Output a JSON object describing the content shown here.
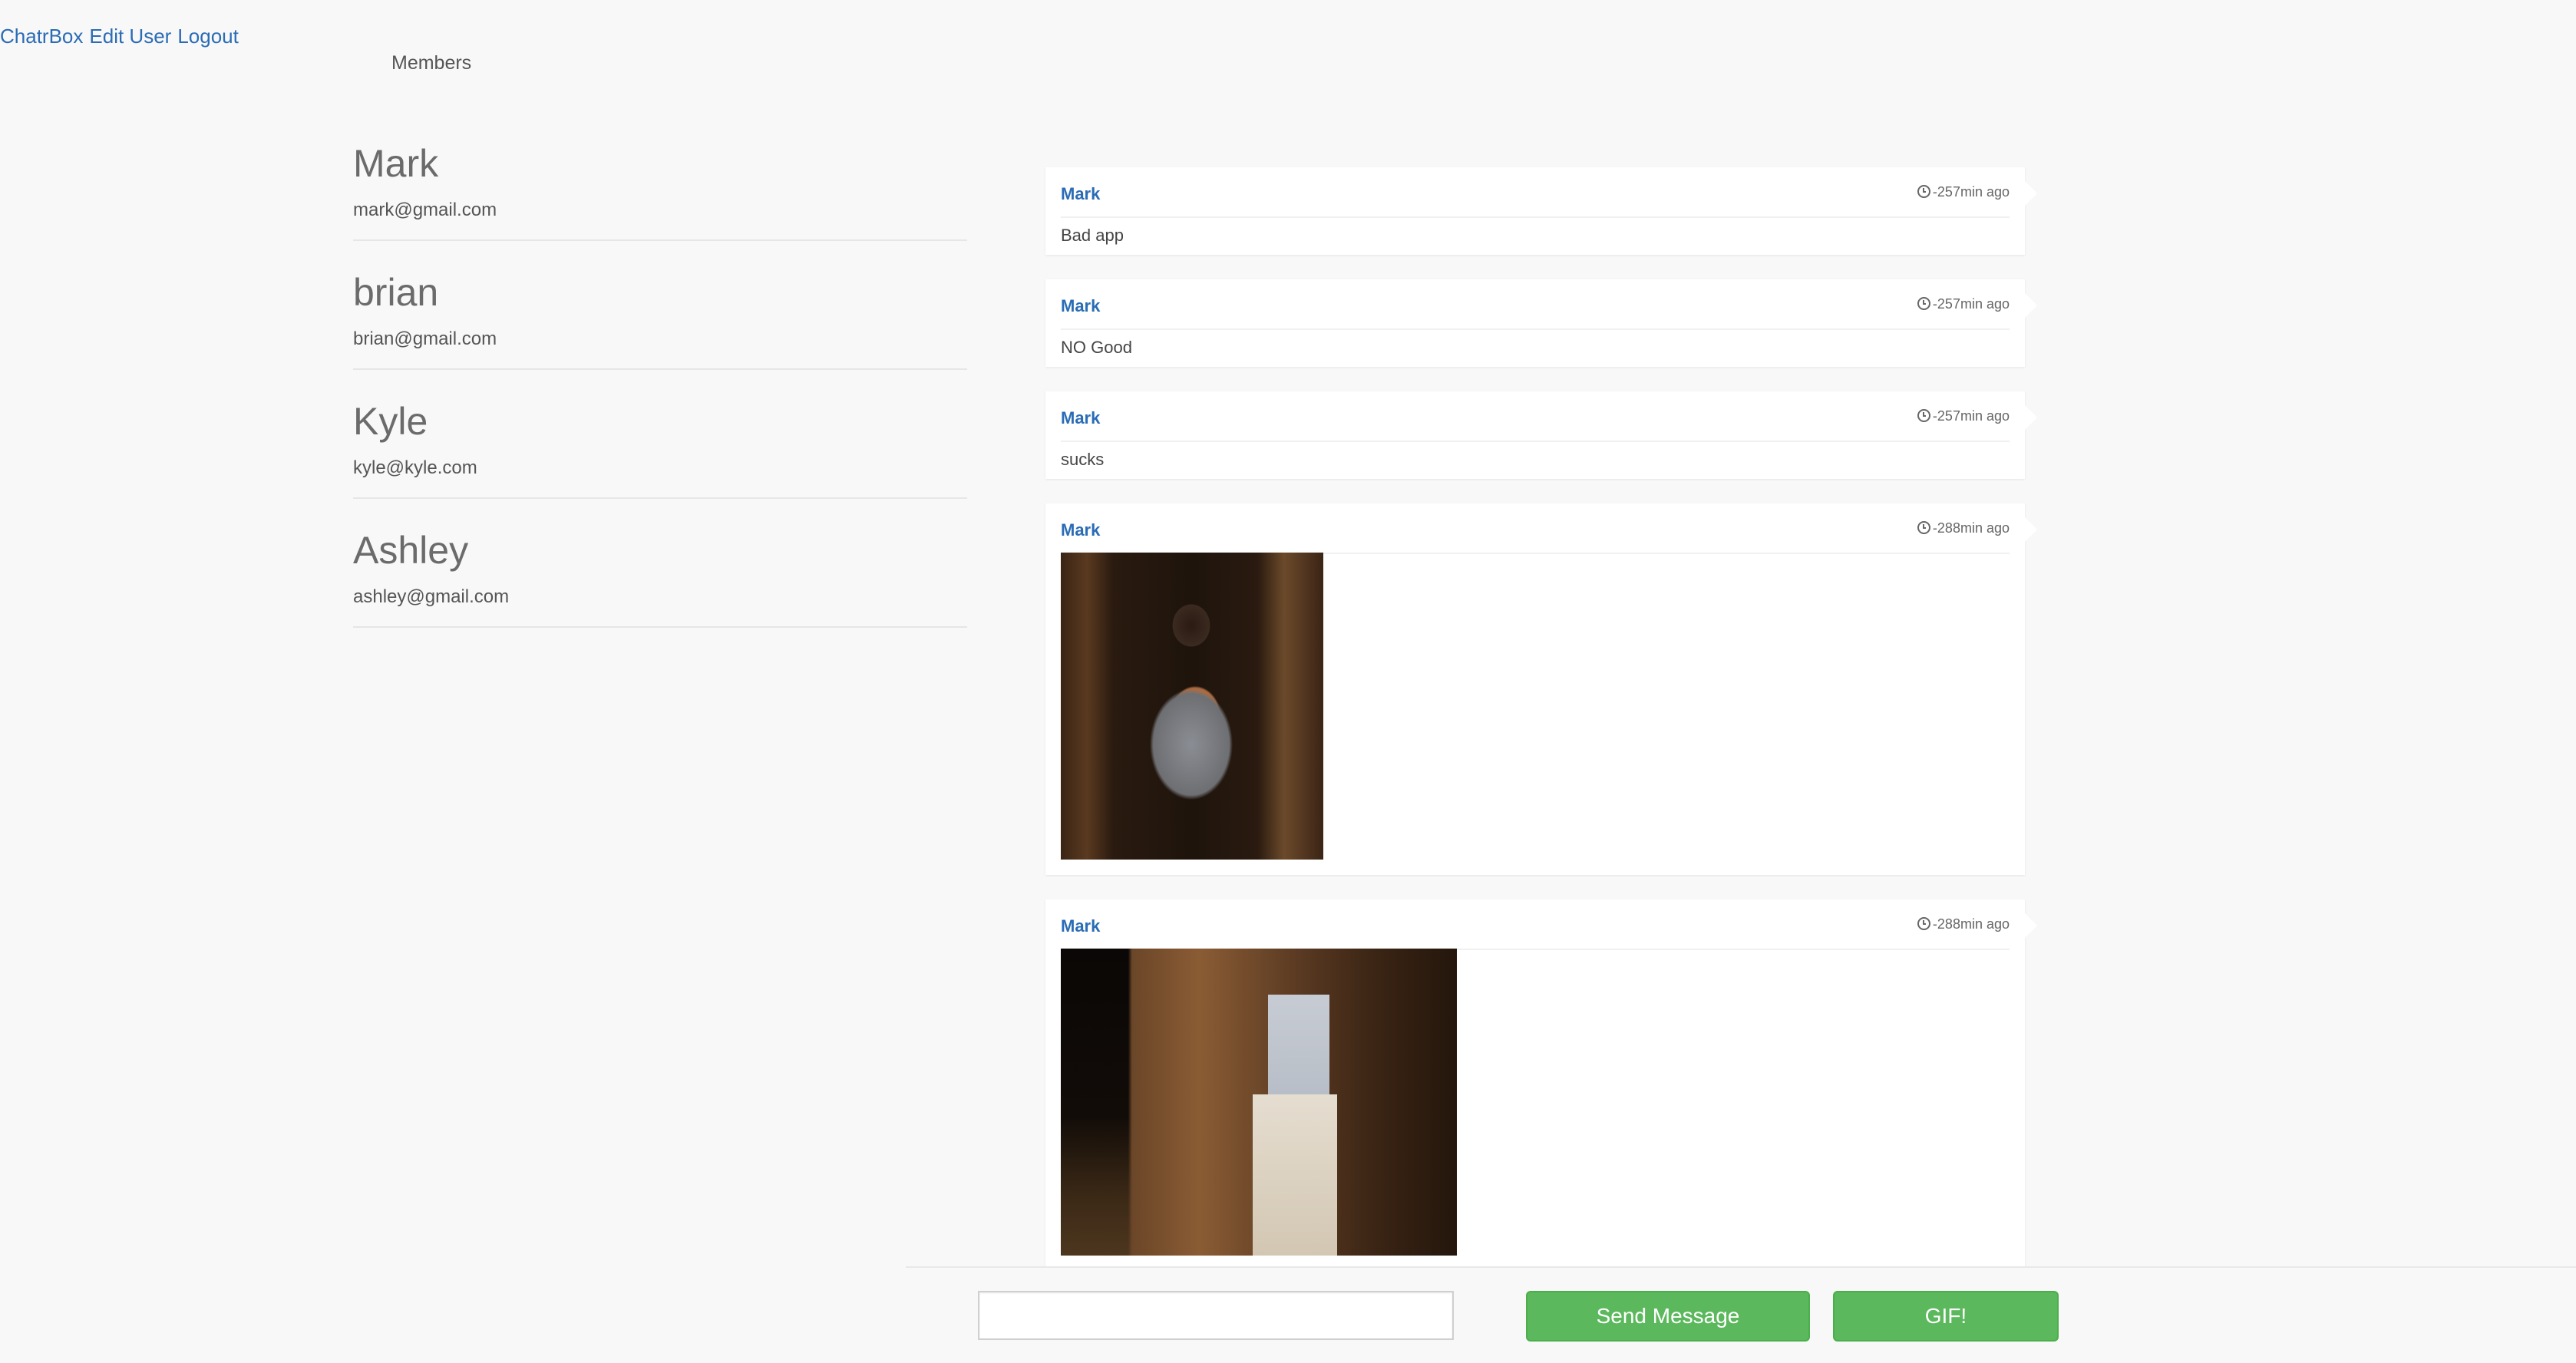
{
  "nav": {
    "links": [
      "ChatrBox",
      "Edit User",
      "Logout"
    ]
  },
  "members": {
    "title": "Members",
    "list": [
      {
        "name": "Mark",
        "email": "mark@gmail.com"
      },
      {
        "name": "brian",
        "email": "brian@gmail.com"
      },
      {
        "name": "Kyle",
        "email": "kyle@kyle.com"
      },
      {
        "name": "Ashley",
        "email": "ashley@gmail.com"
      }
    ]
  },
  "messages": [
    {
      "author": "Mark",
      "time": "-257min ago",
      "text": "Bad app"
    },
    {
      "author": "Mark",
      "time": "-257min ago",
      "text": "NO Good"
    },
    {
      "author": "Mark",
      "time": "-257min ago",
      "text": "sucks"
    },
    {
      "author": "Mark",
      "time": "-288min ago",
      "text": ""
    },
    {
      "author": "Mark",
      "time": "-288min ago",
      "text": ""
    }
  ],
  "composer": {
    "input_value": "",
    "send_label": "Send Message",
    "gif_label": "GIF!"
  },
  "colors": {
    "link": "#2a6cb5",
    "button": "#5cb85c"
  }
}
